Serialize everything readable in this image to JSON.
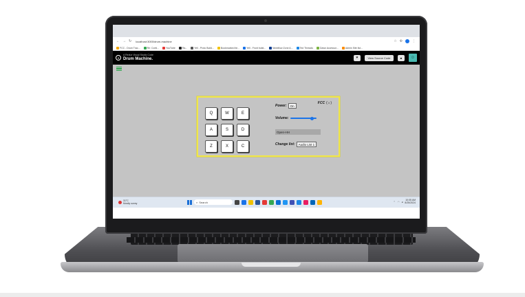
{
  "browser": {
    "url": "localhost:3000/drum-machine",
    "bookmarks": [
      "FCC - Drum Trac...",
      "Re: Conti...",
      "YouTube",
      "Ra...",
      "Yell - Proto Build...",
      "Bookmarked ite...",
      "Yell - Front build...",
      "Workflow Zone A...",
      "Ted Threads",
      "Dawn Accessor...",
      "Admin Site list..."
    ]
  },
  "header": {
    "subtitle": "A Redux Visual Studio Code",
    "title": "Drum Machine.",
    "heart_icon": "♥",
    "source_label": "View Source Code",
    "mini_label": "■",
    "avatar_glyph": "☺"
  },
  "drum": {
    "logo_text": "FCC",
    "logo_brace": "(☼)",
    "pads": [
      "Q",
      "W",
      "E",
      "A",
      "S",
      "D",
      "Z",
      "X",
      "C"
    ],
    "power_label": "Power:",
    "power_value": "On",
    "volume_label": "Volume:",
    "volume_level": 0.88,
    "display_text": "Open-HH",
    "change_label": "Change list:",
    "change_value": "Audio List 1"
  },
  "taskbar": {
    "weather_temp": "31°C",
    "weather_desc": "Mostly sunny",
    "search_label": "Search",
    "time": "10:05 AM",
    "date": "8/25/2024"
  },
  "colors": {
    "accent": "#f0e64a",
    "slider": "#1a73e8",
    "header_bg": "#000000",
    "body_bg": "#c4c4c4"
  }
}
